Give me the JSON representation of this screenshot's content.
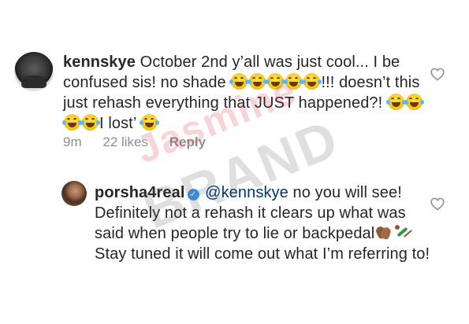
{
  "comments": [
    {
      "username": "kennskye",
      "segments": [
        {
          "type": "text",
          "value": "October 2nd y’all was just cool... I be confused sis! no shade "
        },
        {
          "type": "emoji",
          "name": "face-with-tears-of-joy"
        },
        {
          "type": "emoji",
          "name": "face-with-tears-of-joy"
        },
        {
          "type": "emoji",
          "name": "face-with-tears-of-joy"
        },
        {
          "type": "emoji",
          "name": "face-with-tears-of-joy"
        },
        {
          "type": "emoji",
          "name": "face-with-tears-of-joy"
        },
        {
          "type": "text",
          "value": "!!! doesn’t this just rehash everything that JUST happened?! "
        },
        {
          "type": "emoji",
          "name": "face-with-tears-of-joy"
        },
        {
          "type": "emoji",
          "name": "face-with-tears-of-joy"
        },
        {
          "type": "emoji",
          "name": "face-with-tears-of-joy"
        },
        {
          "type": "emoji",
          "name": "face-with-tears-of-joy"
        },
        {
          "type": "text",
          "value": "I lost’ "
        },
        {
          "type": "emoji",
          "name": "face-with-tears-of-joy"
        }
      ],
      "time": "9m",
      "likes": "22 likes",
      "reply_label": "Reply",
      "like_icon": "heart-outline-icon"
    },
    {
      "username": "porsha4real",
      "verified": true,
      "mention": "@kennskye",
      "text_1": " no you will see! Definitely not a rehash it clears up what was said when people try to lie or backpedal",
      "text_2": " Stay tuned it will come out what I’m referring to!",
      "emojis": [
        "clapping-hands-medium-dark-skin",
        "person-cartwheeling"
      ],
      "like_icon": "heart-outline-icon"
    }
  ],
  "watermark": {
    "line_1": "Jasmine",
    "line_2": "BRAND"
  },
  "colors": {
    "username": "#262626",
    "mention": "#00376b",
    "meta": "#8e8e8e",
    "verified": "#3897f0"
  }
}
